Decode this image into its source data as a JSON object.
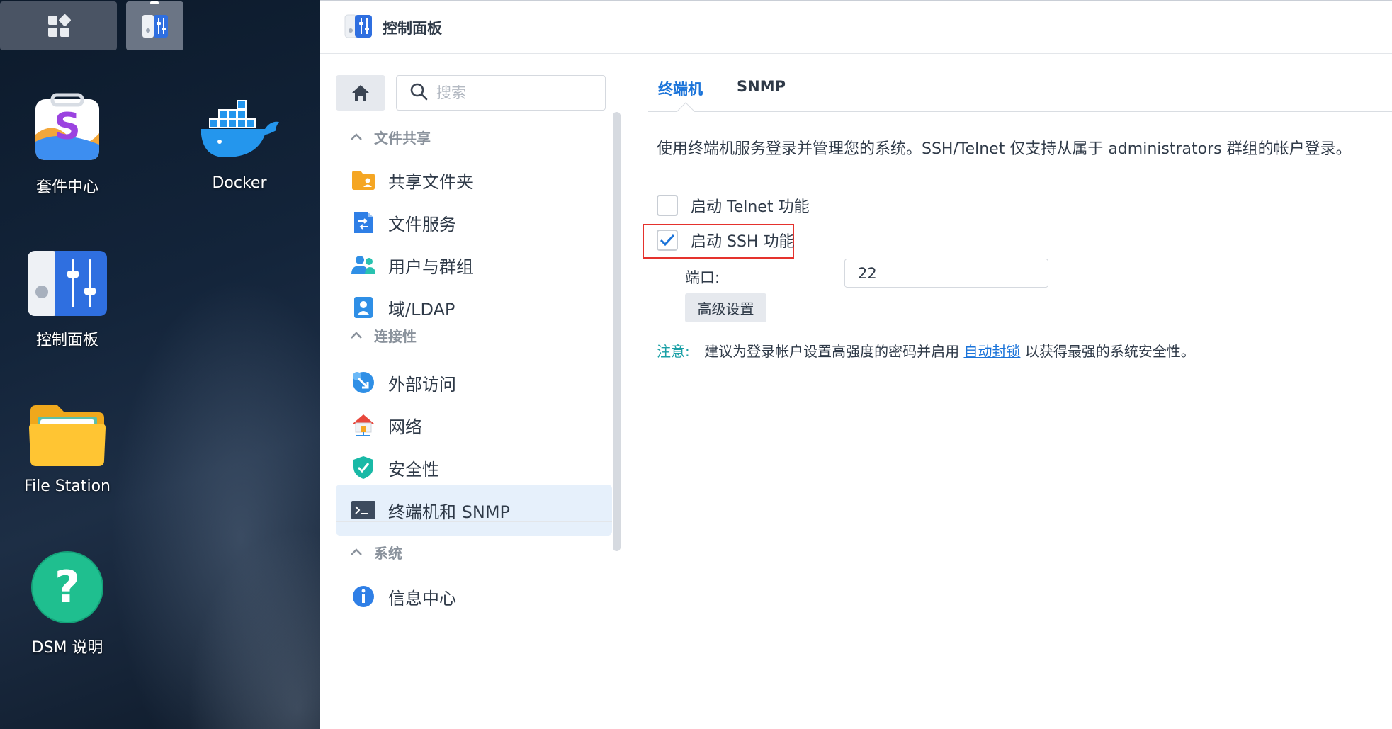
{
  "desktop": {
    "icons": [
      {
        "label": "套件中心",
        "icon": "package-center-icon"
      },
      {
        "label": "Docker",
        "icon": "docker-whale-icon"
      },
      {
        "label": "控制面板",
        "icon": "control-panel-icon"
      },
      {
        "label": "File Station",
        "icon": "folder-icon"
      },
      {
        "label": "DSM 说明",
        "icon": "help-question-icon"
      }
    ]
  },
  "window": {
    "title": "控制面板"
  },
  "sidebar": {
    "search_placeholder": "搜索",
    "sections": [
      {
        "title": "文件共享",
        "items": [
          {
            "label": "共享文件夹",
            "icon": "shared-folder-icon"
          },
          {
            "label": "文件服务",
            "icon": "file-services-icon"
          },
          {
            "label": "用户与群组",
            "icon": "users-groups-icon"
          },
          {
            "label": "域/LDAP",
            "icon": "domain-ldap-icon"
          }
        ]
      },
      {
        "title": "连接性",
        "items": [
          {
            "label": "外部访问",
            "icon": "external-access-icon"
          },
          {
            "label": "网络",
            "icon": "network-house-icon"
          },
          {
            "label": "安全性",
            "icon": "security-shield-icon"
          },
          {
            "label": "终端机和 SNMP",
            "icon": "terminal-icon",
            "active": true
          }
        ]
      },
      {
        "title": "系统",
        "items": [
          {
            "label": "信息中心",
            "icon": "info-center-icon"
          }
        ]
      }
    ]
  },
  "main": {
    "tabs": [
      {
        "label": "终端机",
        "active": true
      },
      {
        "label": "SNMP",
        "active": false
      }
    ],
    "description": "使用终端机服务登录并管理您的系统。SSH/Telnet 仅支持从属于 administrators 群组的帐户登录。",
    "telnet": {
      "label": "启动 Telnet 功能",
      "checked": false
    },
    "ssh": {
      "label": "启动 SSH 功能",
      "checked": true
    },
    "port": {
      "label": "端口:",
      "value": "22"
    },
    "advanced_button": "高级设置",
    "note": {
      "label": "注意:",
      "text_before": "建议为登录帐户设置高强度的密码并启用",
      "link": "自动封锁",
      "text_after": "以获得最强的系统安全性。"
    }
  },
  "colors": {
    "accent": "#1a73d9",
    "active_item_bg": "#e6f0fb",
    "highlight_border": "#e5322d",
    "note_label": "#1aa0a6"
  }
}
